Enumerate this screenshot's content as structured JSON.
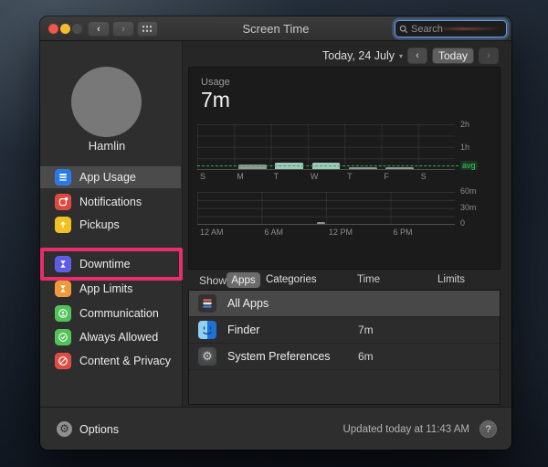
{
  "window_title": "Screen Time",
  "titlebar": {
    "search_placeholder": "Search"
  },
  "icons": {
    "back": "‹",
    "forward": "›",
    "chevron_down": "▾",
    "gear": "⚙",
    "help": "?"
  },
  "toolbar": {
    "date_label": "Today, 24 July",
    "today_label": "Today"
  },
  "sidebar": {
    "user_name": "Hamlin",
    "items": [
      {
        "label": "App Usage",
        "icon_color": "#2979e8",
        "selected": true
      },
      {
        "label": "Notifications",
        "icon_color": "#e0483e",
        "selected": false
      },
      {
        "label": "Pickups",
        "icon_color": "#f1c121",
        "selected": false
      },
      {
        "label": "Downtime",
        "icon_color": "#5e5ce6",
        "selected": false,
        "annotated": true
      },
      {
        "label": "App Limits",
        "icon_color": "#ef9a37",
        "selected": false
      },
      {
        "label": "Communication",
        "icon_color": "#4fc357",
        "selected": false
      },
      {
        "label": "Always Allowed",
        "icon_color": "#4fc357",
        "selected": false
      },
      {
        "label": "Content & Privacy",
        "icon_color": "#de4b40",
        "selected": false
      }
    ],
    "options_label": "Options"
  },
  "usage_summary": {
    "label": "Usage",
    "total": "7m"
  },
  "chart_data": [
    {
      "type": "bar",
      "title": "Usage by day (past week)",
      "categories": [
        "S",
        "M",
        "T",
        "W",
        "T",
        "F",
        "S"
      ],
      "x_tick_labels": [
        "S",
        "M",
        "T",
        "W",
        "T",
        "F",
        "S"
      ],
      "x_tick_slots": [
        0,
        1,
        2,
        3,
        4,
        5,
        6
      ],
      "slots": 7,
      "values": [
        0,
        12,
        18,
        18,
        4,
        5,
        0
      ],
      "unit": "minutes",
      "bar_colors": [
        "#8f9a94",
        "#8f9a94",
        "#9fc8bc",
        "#9fc8bc",
        "#8f9a94",
        "#8f9a94",
        "#8f9a94"
      ],
      "avg": 8,
      "avg_label": "avg",
      "ylim": [
        0,
        120
      ],
      "ytick_labels": [
        "2h",
        "1h"
      ],
      "grid": true,
      "legend": false
    },
    {
      "type": "bar",
      "title": "Usage by hour (today)",
      "x_tick_labels": [
        "12 AM",
        "6 AM",
        "12 PM",
        "6 PM"
      ],
      "x_tick_slots": [
        0,
        6,
        12,
        18
      ],
      "slots": 24,
      "values": [
        0,
        0,
        0,
        0,
        0,
        0,
        0,
        0,
        0,
        0,
        0,
        4,
        0,
        0,
        0,
        0,
        0,
        0,
        0,
        0,
        0,
        0,
        0,
        0
      ],
      "unit": "minutes",
      "bar_color": "#8f948f",
      "bar_colors": [],
      "ylim": [
        0,
        60
      ],
      "ytick_labels": [
        "60m",
        "30m",
        "0"
      ],
      "grid": true,
      "legend": false
    }
  ],
  "show_row": {
    "label": "Show:",
    "segments": [
      "Apps",
      "Categories"
    ],
    "selected_segment": "Apps",
    "columns": [
      "Time",
      "Limits"
    ]
  },
  "app_list": [
    {
      "name": "All Apps",
      "time": "",
      "selected": true
    },
    {
      "name": "Finder",
      "time": "7m",
      "selected": false
    },
    {
      "name": "System Preferences",
      "time": "6m",
      "selected": false
    }
  ],
  "footer": {
    "updated": "Updated today at 11:43 AM"
  },
  "annotation": {
    "purpose": "highlight-downtime-item",
    "color": "#e72e6b"
  },
  "colors": {
    "annotation_pink": "#e72e6b",
    "avg_green": "#30d158",
    "bar_teal": "#9fc8bc",
    "bar_gray": "#8f9a94",
    "focus_ring_blue": "#4a86d8",
    "sidebar_selection": "#4b4b4b"
  }
}
